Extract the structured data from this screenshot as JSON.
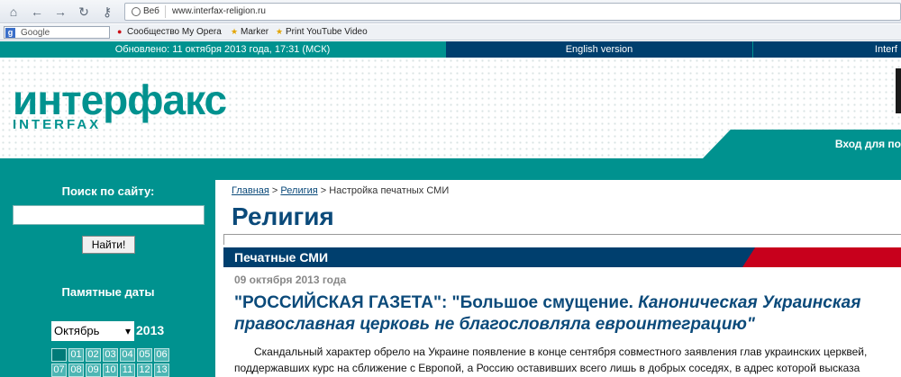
{
  "browser": {
    "web_label": "Веб",
    "url": "www.interfax-religion.ru",
    "search_placeholder": "Google",
    "bookmarks": [
      {
        "label": "Сообщество My Opera",
        "icon": "opera-icon"
      },
      {
        "label": "Marker",
        "icon": "star-icon"
      },
      {
        "label": "Print YouTube Video",
        "icon": "star-icon"
      }
    ]
  },
  "topbar": {
    "updated": "Обновлено: 11 октября 2013 года, 17:31 (МСК)",
    "english": "English version",
    "interf": "Interf"
  },
  "header": {
    "logo_main": "интерфакс",
    "logo_sub": "INTERFAX",
    "login": "Вход для по"
  },
  "sidebar": {
    "search_title": "Поиск по сайту:",
    "find_button": "Найти!",
    "dates_title": "Памятные даты",
    "month": "Октябрь",
    "year": "2013",
    "days": [
      "",
      "01",
      "02",
      "03",
      "04",
      "05",
      "06",
      "07",
      "08",
      "09",
      "10",
      "11",
      "12",
      "13"
    ]
  },
  "main": {
    "breadcrumb": {
      "home": "Главная",
      "sep1": " > ",
      "religion": "Религия",
      "sep2": " > ",
      "current": "Настройка печатных СМИ"
    },
    "section_title": "Религия",
    "subsection": "Печатные СМИ",
    "date": "09 октября 2013 года",
    "headline_plain": "\"РОССИЙСКАЯ ГАЗЕТА\": \"Большое смущение. ",
    "headline_italic": "Каноническая Украинская православная церковь не благословляла евроинтеграцию\"",
    "body_line1": "Скандальный характер обрело на Украине появление в конце сентября совместного заявления глав украинских церквей,",
    "body_line2": "поддержавших курс на сближение с Европой, а Россию оставивших всего лишь в добрых соседях, в адрес которой высказа"
  },
  "colors": {
    "teal": "#00928f",
    "navy": "#003f6e",
    "red": "#c8001c"
  }
}
